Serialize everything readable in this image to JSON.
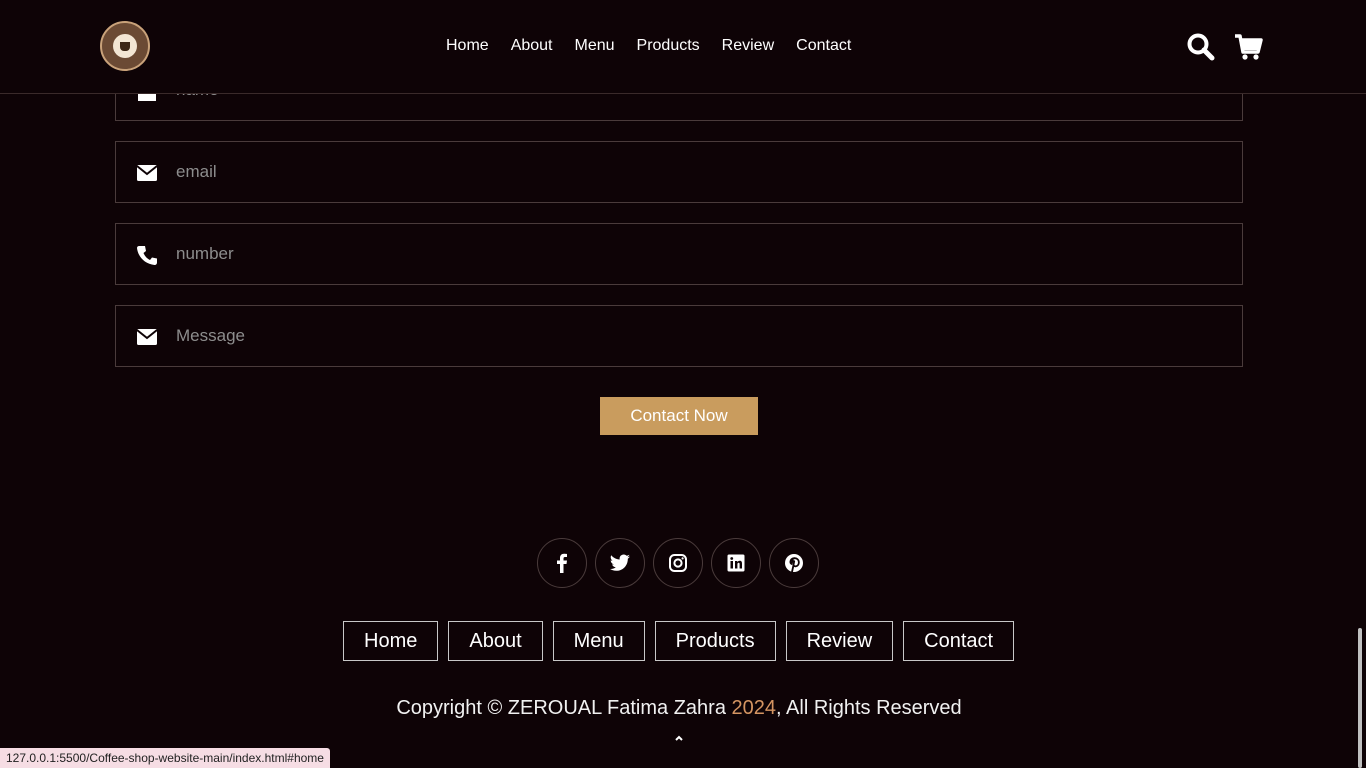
{
  "header": {
    "nav": [
      "Home",
      "About",
      "Menu",
      "Products",
      "Review",
      "Contact"
    ]
  },
  "form": {
    "fields": [
      {
        "placeholder": "name",
        "icon": "user-icon"
      },
      {
        "placeholder": "email",
        "icon": "envelope-icon"
      },
      {
        "placeholder": "number",
        "icon": "phone-icon"
      },
      {
        "placeholder": "Message",
        "icon": "envelope-icon"
      }
    ],
    "submit_label": "Contact Now"
  },
  "footer": {
    "socials": [
      "facebook-icon",
      "twitter-icon",
      "instagram-icon",
      "linkedin-icon",
      "pinterest-icon"
    ],
    "nav": [
      "Home",
      "About",
      "Menu",
      "Products",
      "Review",
      "Contact"
    ],
    "copyright_prefix": "Copyright © ZEROUAL Fatima Zahra ",
    "copyright_year": "2024",
    "copyright_suffix": ", All Rights Reserved"
  },
  "status_url": "127.0.0.1:5500/Coffee-shop-website-main/index.html#home",
  "colors": {
    "background": "#0e0306",
    "accent": "#c99c5e",
    "year": "#d59562"
  }
}
